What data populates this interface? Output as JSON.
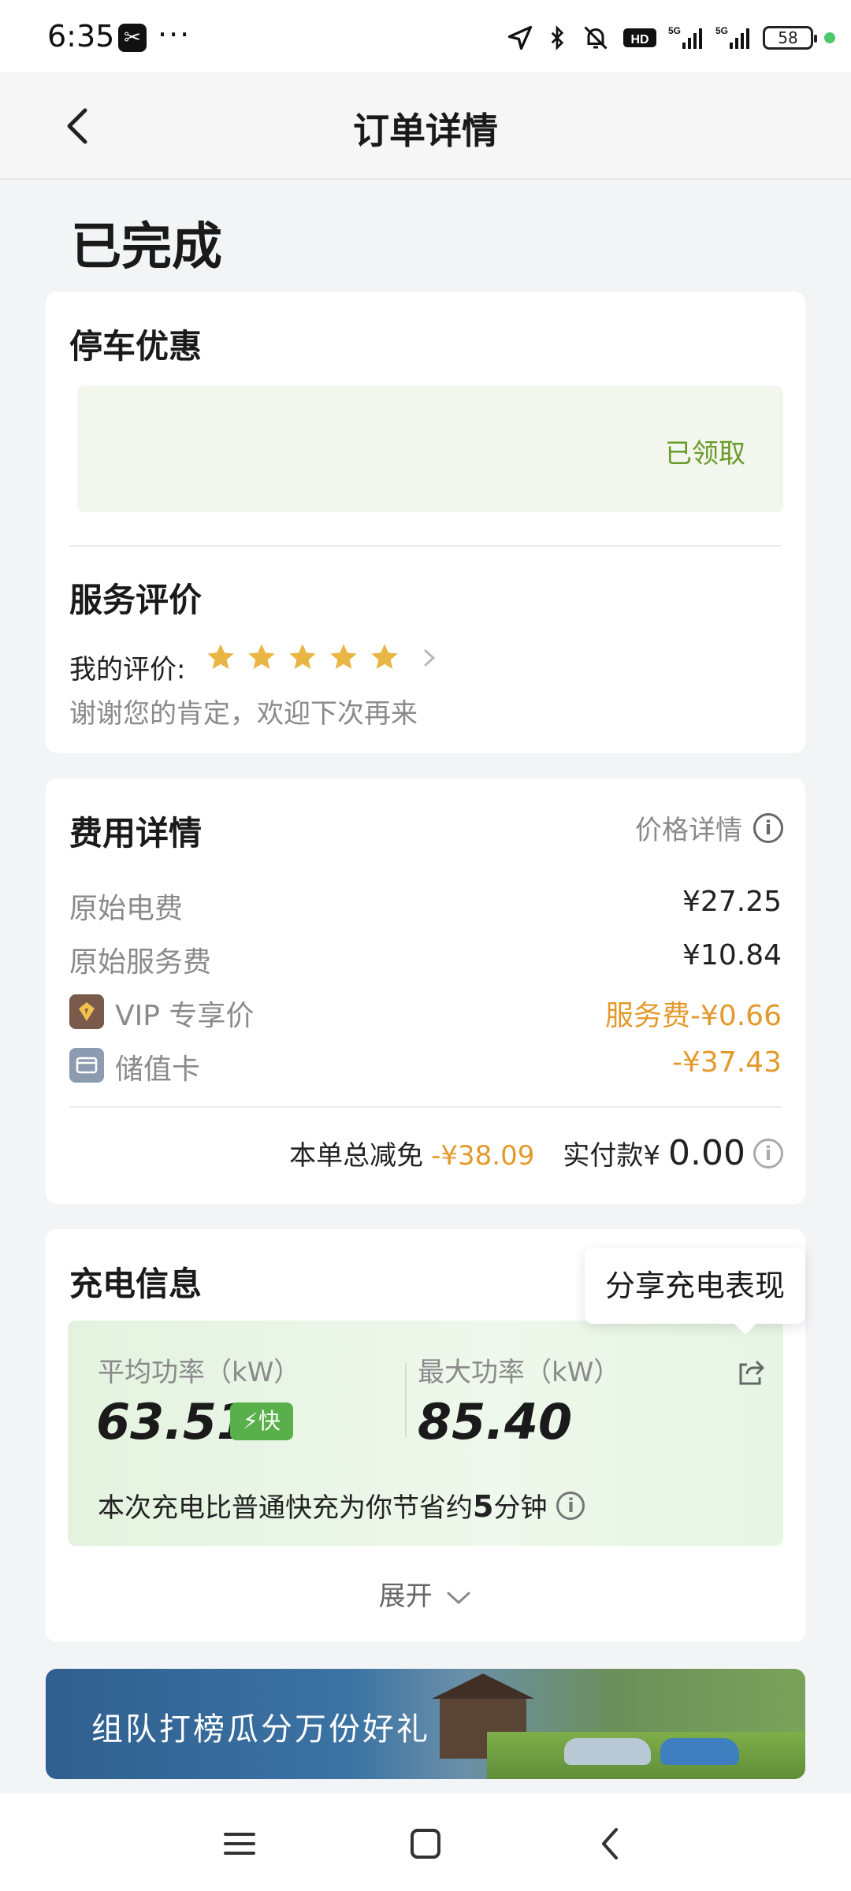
{
  "status_bar": {
    "time": "6:35",
    "app_icon": "capcut-icon",
    "dots": "···",
    "network_labels": [
      "HD",
      "5G",
      "5G"
    ],
    "battery": "58"
  },
  "header": {
    "title": "订单详情",
    "back_icon": "chevron-left-icon"
  },
  "order_status": "已完成",
  "parking": {
    "title": "停车优惠",
    "coupon_status": "已领取"
  },
  "service_rating": {
    "title": "服务评价",
    "label": "我的评价:",
    "stars": 5,
    "max_stars": 5,
    "thanks": "谢谢您的肯定，欢迎下次再来"
  },
  "fees": {
    "title": "费用详情",
    "price_detail_label": "价格详情",
    "rows": [
      {
        "label": "原始电费",
        "value": "¥27.25"
      },
      {
        "label": "原始服务费",
        "value": "¥10.84"
      },
      {
        "label": "VIP 专享价",
        "value": "服务费-¥0.66",
        "icon": "vip-gem-icon"
      },
      {
        "label": "储值卡",
        "value": "-¥37.43",
        "icon": "wallet-card-icon"
      }
    ],
    "total_discount_label": "本单总减免",
    "total_discount_value": "-¥38.09",
    "paid_label": "实付款¥",
    "paid_value": "0.00"
  },
  "charging": {
    "title": "充电信息",
    "share_tooltip": "分享充电表现",
    "avg_power_label": "平均功率（kW）",
    "avg_power_value": "63.51",
    "fast_badge": "⚡快",
    "max_power_label": "最大功率（kW）",
    "max_power_value": "85.40",
    "saving_text": "本次充电比普通快充为你节省约",
    "saving_value": "5",
    "saving_unit": "分钟",
    "expand_label": "展开"
  },
  "banner": {
    "text": "组队打榜瓜分万份好礼"
  },
  "colors": {
    "accent_orange": "#e39a2c",
    "accent_green": "#6a9a2a",
    "star_gold": "#e9b543",
    "fast_badge_green": "#59b04a"
  }
}
